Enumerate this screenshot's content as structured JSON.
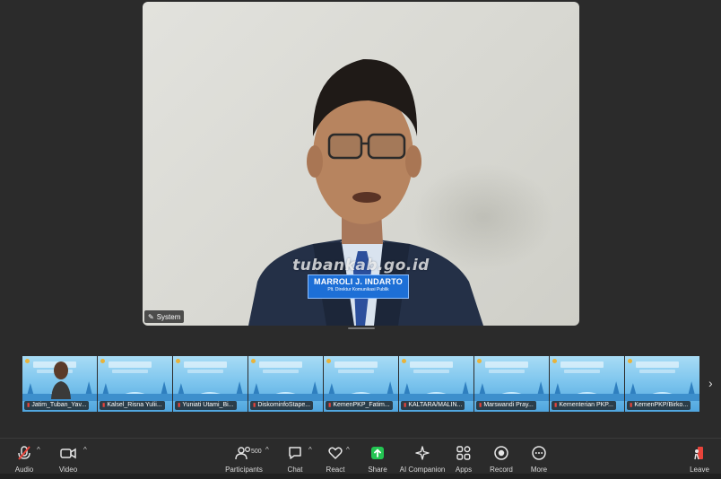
{
  "main_video": {
    "watermark": "tubankab.go.id",
    "nameplate": {
      "name": "MARROLI J. INDARTO",
      "title": "Plt. Direktur Komunikasi Publik"
    },
    "system_label": "System"
  },
  "thumbnails": [
    {
      "label": "Jatim_Tuban_Yav...",
      "muted": true,
      "has_person": true
    },
    {
      "label": "Kalsel_Risna Yulii...",
      "muted": true,
      "has_person": false
    },
    {
      "label": "Yuniati Utami_Bi...",
      "muted": true,
      "has_person": false
    },
    {
      "label": "DiskominfoStape...",
      "muted": true,
      "has_person": false
    },
    {
      "label": "KemenPKP_Fatim...",
      "muted": true,
      "has_person": false
    },
    {
      "label": "KALTARA/MALIN...",
      "muted": true,
      "has_person": false
    },
    {
      "label": "Marswandi Pray...",
      "muted": true,
      "has_person": false
    },
    {
      "label": "Kementerian PKP...",
      "muted": true,
      "has_person": false
    },
    {
      "label": "KemenPKP/Birko...",
      "muted": true,
      "has_person": false
    }
  ],
  "toolbar": {
    "audio": "Audio",
    "video": "Video",
    "participants": "Participants",
    "participants_count": "500",
    "chat": "Chat",
    "react": "React",
    "share": "Share",
    "ai_companion": "AI Companion",
    "apps": "Apps",
    "record": "Record",
    "more": "More",
    "leave": "Leave"
  },
  "colors": {
    "background": "#2b2b2b",
    "share_green": "#23c552",
    "nameplate_blue": "#1d6fd6",
    "muted_red": "#e8433a"
  }
}
